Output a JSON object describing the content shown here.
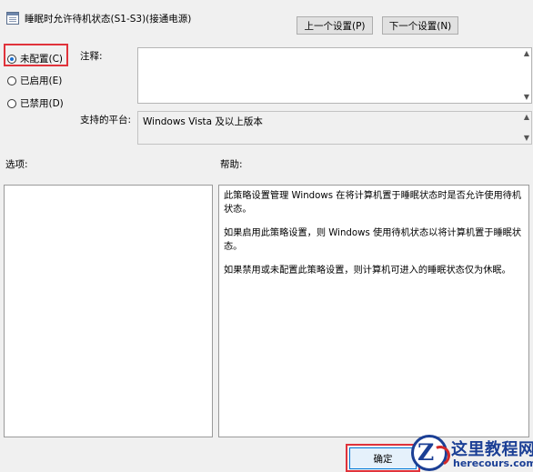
{
  "window": {
    "title": "睡眠时允许待机状态(S1-S3)(接通电源)",
    "icon": "policy-icon"
  },
  "nav": {
    "prev_label": "上一个设置(P)",
    "next_label": "下一个设置(N)"
  },
  "state": {
    "options": [
      {
        "label": "未配置(C)",
        "checked": true
      },
      {
        "label": "已启用(E)",
        "checked": false
      },
      {
        "label": "已禁用(D)",
        "checked": false
      }
    ]
  },
  "comment": {
    "label": "注释:",
    "value": ""
  },
  "platform": {
    "label": "支持的平台:",
    "value": "Windows Vista 及以上版本"
  },
  "options_pane": {
    "label": "选项:"
  },
  "help": {
    "label": "帮助:",
    "paragraphs": [
      "此策略设置管理 Windows 在将计算机置于睡眠状态时是否允许使用待机状态。",
      "如果启用此策略设置，则 Windows 使用待机状态以将计算机置于睡眠状态。",
      "如果禁用或未配置此策略设置，则计算机可进入的睡眠状态仅为休眠。"
    ]
  },
  "footer": {
    "ok_label": "确定"
  },
  "watermark": {
    "logo_letter": "Z",
    "title": "这里教程网",
    "url": "herecours.com"
  },
  "colors": {
    "highlight": "#e0333b",
    "radio_checked": "#1a6fd0",
    "watermark_blue": "#1b3f95"
  }
}
